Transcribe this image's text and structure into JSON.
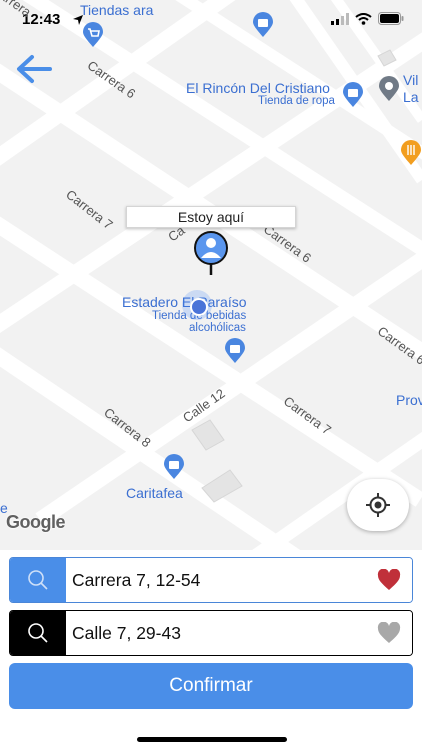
{
  "status_bar": {
    "time": "12:43"
  },
  "map": {
    "streets": {
      "carrera_6_top": "Carrera 6",
      "carrera_7_left": "Carrera 7",
      "carrera_6_right": "Carrera 6",
      "carrera_6_far_right": "Carrera 6",
      "calle_partial": "Ca",
      "calle_12": "Calle 12",
      "carrera_8": "Carrera 8",
      "carrera_7_bottom": "Carrera 7",
      "top_left_partial": "arrera"
    },
    "pois": {
      "tiendas": "Tiendas ara",
      "rincon_name": "El Rincón Del Cristiano",
      "rincon_sub": "Tienda de ropa",
      "vil_partial_1": "Vil",
      "vil_partial_2": "La",
      "estadero_name": "Estadero El Paraíso",
      "estadero_sub_1": "Tienda de bebidas",
      "estadero_sub_2": "alcohólicas",
      "prov_partial": "Prov",
      "caritafea": "Caritafea",
      "e_partial": "e"
    },
    "tooltip": "Estoy aquí",
    "google_logo": "Google"
  },
  "search": {
    "origin_value": "Carrera 7, 12-54",
    "destination_value": "Calle 7, 29-43"
  },
  "confirm_label": "Confirmar",
  "colors": {
    "accent": "#4a8ee8",
    "favorite_active": "#c0303a",
    "favorite_inactive": "#a8a8a8",
    "poi_text": "#3b6fd1"
  }
}
